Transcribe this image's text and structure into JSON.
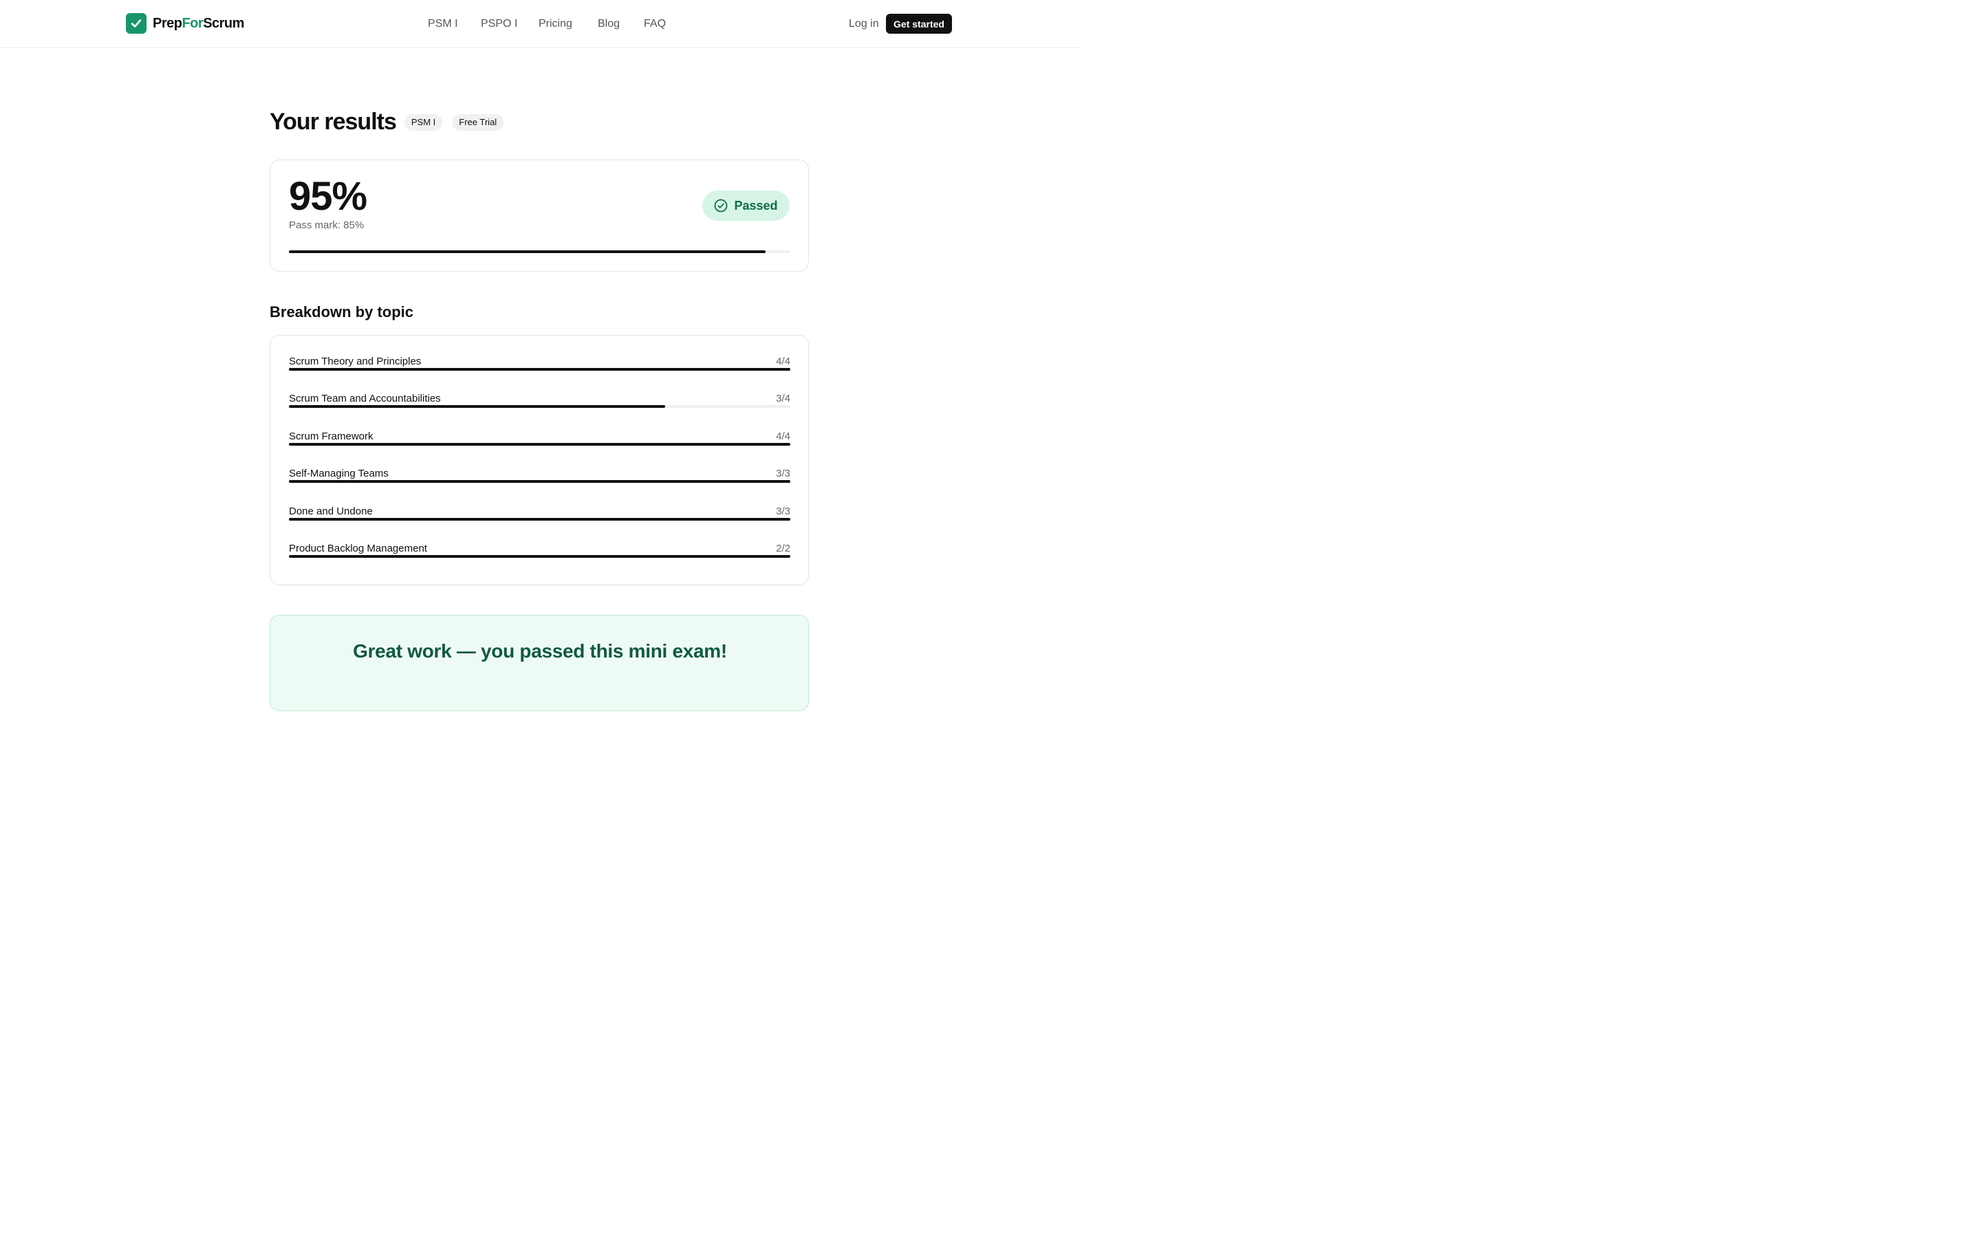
{
  "header": {
    "brand": {
      "part1": "Prep",
      "part2": "For",
      "part3": "Scrum"
    },
    "nav": [
      {
        "label": "PSM I"
      },
      {
        "label": "PSPO I"
      },
      {
        "label": "Pricing"
      },
      {
        "label": "Blog"
      },
      {
        "label": "FAQ"
      }
    ],
    "login_label": "Log in",
    "cta_label": "Get started"
  },
  "results": {
    "title": "Your results",
    "tags": [
      "PSM I",
      "Free Trial"
    ],
    "score_text": "95%",
    "score_value": 95,
    "pass_mark_text": "Pass mark: 85%",
    "status_label": "Passed"
  },
  "breakdown": {
    "title": "Breakdown by topic",
    "topics": [
      {
        "label": "Scrum Theory and Principles",
        "score": "4/4",
        "correct": 4,
        "total": 4
      },
      {
        "label": "Scrum Team and Accountabilities",
        "score": "3/4",
        "correct": 3,
        "total": 4
      },
      {
        "label": "Scrum Framework",
        "score": "4/4",
        "correct": 4,
        "total": 4
      },
      {
        "label": "Self-Managing Teams",
        "score": "3/3",
        "correct": 3,
        "total": 3
      },
      {
        "label": "Done and Undone",
        "score": "3/3",
        "correct": 3,
        "total": 3
      },
      {
        "label": "Product Backlog Management",
        "score": "2/2",
        "correct": 2,
        "total": 2
      }
    ]
  },
  "congrats": {
    "title": "Great work — you passed this mini exam!",
    "subtitle": ""
  },
  "colors": {
    "brand_green": "#17966a",
    "passed_bg": "#d6f5e6",
    "passed_text": "#0f6b4a",
    "progress": "#111111"
  },
  "icons": {
    "logo": "check-square-icon",
    "status": "check-circle-icon"
  }
}
